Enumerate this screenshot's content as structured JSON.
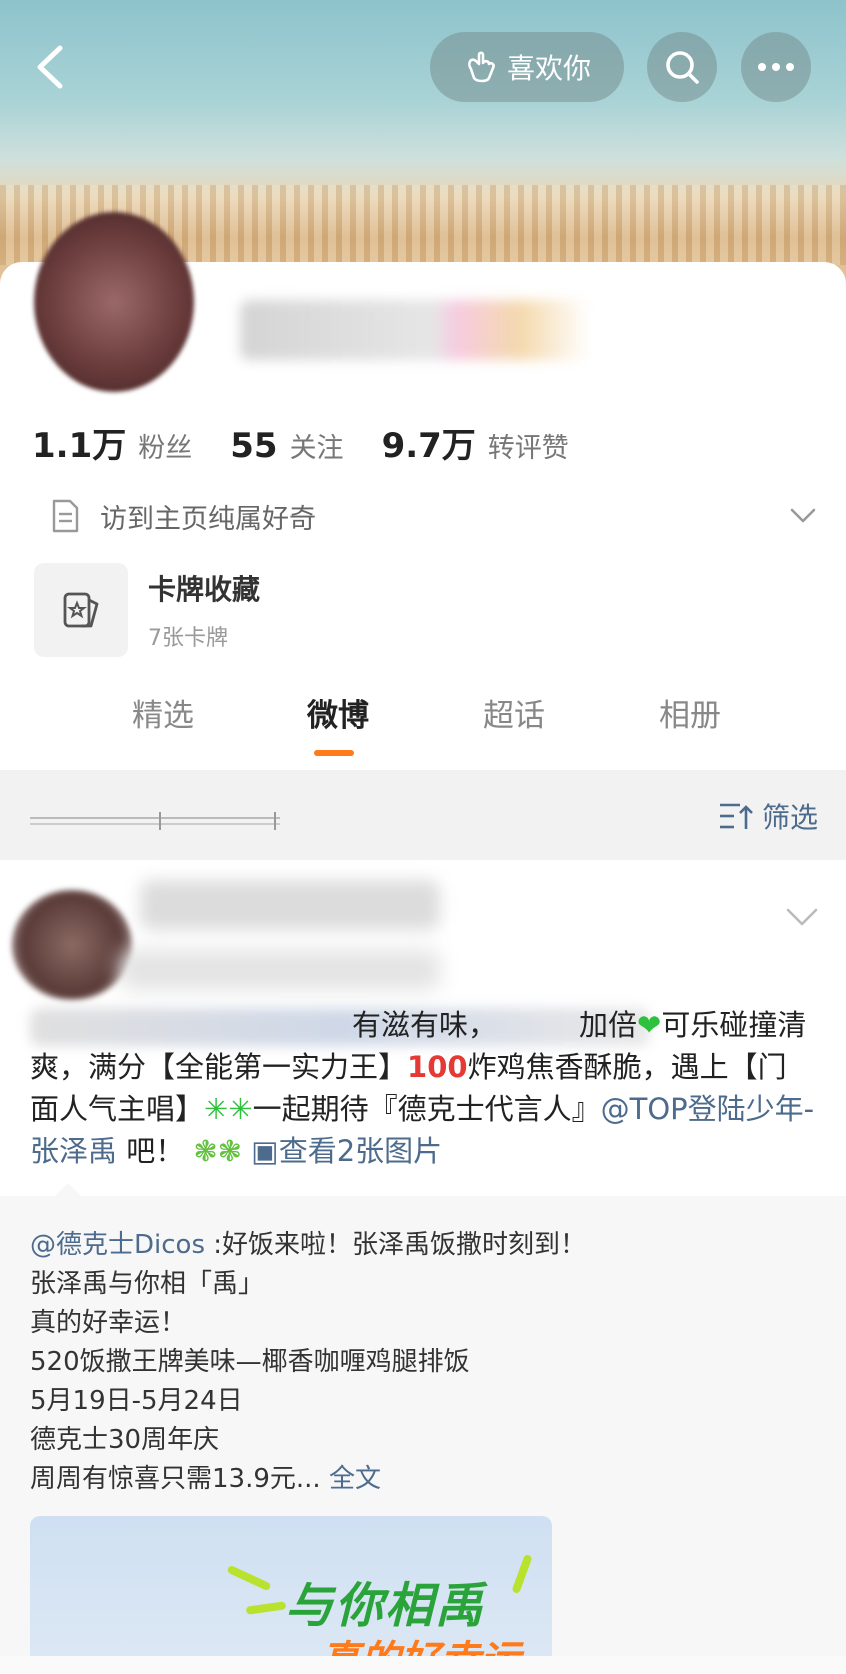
{
  "header": {
    "like_label": "喜欢你",
    "icons": [
      "chevron-left-icon",
      "hand-heart-icon",
      "search-icon",
      "more-icon"
    ]
  },
  "profile": {
    "stats": [
      {
        "num": "1.1万",
        "label": "粉丝"
      },
      {
        "num": "55",
        "label": "关注"
      },
      {
        "num": "9.7万",
        "label": "转评赞"
      }
    ],
    "bio": "访到主页纯属好奇",
    "card_collection": {
      "title": "卡牌收藏",
      "subtitle": "7张卡牌"
    }
  },
  "tabs": [
    {
      "label": "精选",
      "active": false
    },
    {
      "label": "微博",
      "active": true
    },
    {
      "label": "超话",
      "active": false
    },
    {
      "label": "相册",
      "active": false
    }
  ],
  "colors": {
    "accent": "#ff7a1a",
    "link": "#4d6b8c"
  },
  "filter": {
    "label": "筛选"
  },
  "post": {
    "line1_visible_a": "有滋有味，",
    "line1_visible_b": "加倍",
    "line1_visible_c": "可乐碰撞清",
    "line2": "爽，满分【全能第一实力王】",
    "line2_b": "炸鸡焦香酥脆，遇上【门",
    "line3_a": "面人气主唱】",
    "line3_b": "一起期待『德克士代言人』",
    "mention": "@TOP登陆少年-张泽禹",
    "line4_b": " 吧！",
    "image_link": "查看2张图片",
    "repost": {
      "author": "@德克士Dicos",
      "first": " :好饭来啦！张泽禹饭撒时刻到！",
      "lines": [
        "张泽禹与你相「禹」",
        "真的好幸运！",
        "520饭撒王牌美味—椰香咖喱鸡腿排饭",
        "5月19日-5月24日",
        "德克士30周年庆"
      ],
      "last": "周周有惊喜只需13.9元...",
      "full_text": "全文",
      "image_title": "与你相禹",
      "image_sub": "真的好幸运"
    }
  }
}
